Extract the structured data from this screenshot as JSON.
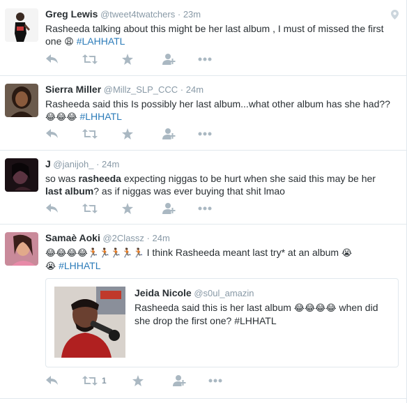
{
  "tweets": [
    {
      "fullname": "Greg Lewis",
      "username": "@tweet4twatchers",
      "time": "23m",
      "text_line1": "Rasheeda talking about this might be her last album , I must of missed the first",
      "text_line2_pre": "one ",
      "text_line2_emoji": "😩",
      "hashtag": "#LAHHATL"
    },
    {
      "fullname": "Sierra Miller",
      "username": "@Millz_SLP_CCC",
      "time": "24m",
      "text_line1": "Rasheeda said this Is possibly her last album...what other album has she had??",
      "text_line2_emoji": "😂😂😂",
      "hashtag": "#LHHATL"
    },
    {
      "fullname": "J",
      "username": "@janijoh_",
      "time": "24m",
      "text_line1_pre": "so was ",
      "text_line1_strong": "rasheeda",
      "text_line1_post": " expecting niggas to be hurt when she said this may be her",
      "text_line2_strong": "last album",
      "text_line2_post": "? as if niggas was ever buying that shit lmao"
    },
    {
      "fullname": "Samaè Aoki",
      "username": "@2Classz",
      "time": "24m",
      "text_line1_emoji": "😂😂😂😂🏃🏾🏃🏾🏃🏾🏃🏾🏃🏾",
      "text_line1_post": " I think Rasheeda meant last try* at an album ",
      "text_line1_emoji_end": "😭",
      "text_line2_emoji": "😭",
      "hashtag": "#LHHATL",
      "retweet_count": "1",
      "quote": {
        "fullname": "Jeida Nicole",
        "username": "@s0ul_amazin",
        "text_line1_pre": "Rasheeda said this is her last album ",
        "text_line1_emoji": "😂😂😂😂",
        "text_line1_post": " when did",
        "text_line2": "she drop the first one?  #LHHATL"
      }
    }
  ],
  "icons": [
    "reply-icon",
    "retweet-icon",
    "favorite-icon",
    "follow-icon",
    "more-icon",
    "geo-pin-icon"
  ],
  "colors": {
    "hashtag": "#2b7bb9",
    "muted": "#8899a6",
    "icon": "#aab8c2",
    "border": "#e1e8ed"
  }
}
